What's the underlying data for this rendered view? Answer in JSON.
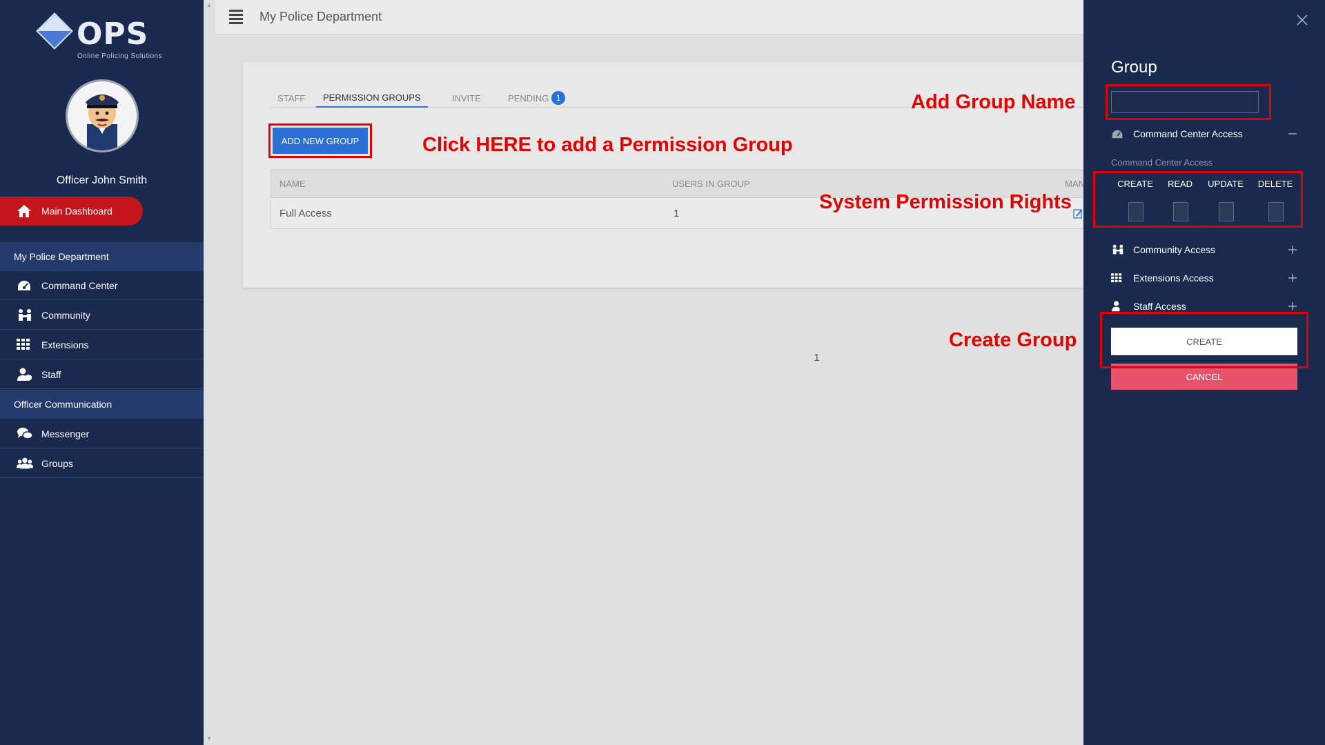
{
  "app": {
    "logo_text": "OPS",
    "logo_tagline": "Online Policing Solutions",
    "header_title": "My Police Department"
  },
  "user": {
    "name": "Officer John Smith"
  },
  "sidebar": {
    "dashboard_label": "Main Dashboard",
    "section1": "My Police Department",
    "items1": [
      {
        "label": "Command Center",
        "icon": "dashboard-icon"
      },
      {
        "label": "Community",
        "icon": "community-icon"
      },
      {
        "label": "Extensions",
        "icon": "grid-icon"
      },
      {
        "label": "Staff",
        "icon": "staff-icon"
      }
    ],
    "section2": "Officer Communication",
    "items2": [
      {
        "label": "Messenger",
        "icon": "chat-icon"
      },
      {
        "label": "Groups",
        "icon": "groups-icon"
      }
    ]
  },
  "tabs": [
    {
      "label": "STAFF"
    },
    {
      "label": "PERMISSION GROUPS",
      "active": true
    },
    {
      "label": "INVITE"
    },
    {
      "label": "PENDING",
      "badge": "1"
    }
  ],
  "add_button": "ADD NEW GROUP",
  "table": {
    "columns": [
      "NAME",
      "USERS IN GROUP",
      "MAN"
    ],
    "rows": [
      {
        "name": "Full Access",
        "users": "1"
      }
    ],
    "page": "1"
  },
  "annotations": {
    "add_group": "Click HERE to add a Permission Group",
    "group_name": "Add Group Name",
    "permission_rights": "System Permission Rights",
    "create_group": "Create Group"
  },
  "panel": {
    "title": "Group",
    "name_value": "",
    "command_center": "Command Center Access",
    "sub_label": "Command Center Access",
    "permissions": [
      "CREATE",
      "READ",
      "UPDATE",
      "DELETE"
    ],
    "community": "Community Access",
    "extensions": "Extensions Access",
    "staff": "Staff Access",
    "create": "CREATE",
    "cancel": "CANCEL"
  },
  "colors": {
    "navy": "#1a2a4e",
    "accent_red": "#c4161c",
    "primary_blue": "#2a6fd6",
    "annotation_red": "#e30000",
    "cancel_pink": "#e8526b"
  }
}
